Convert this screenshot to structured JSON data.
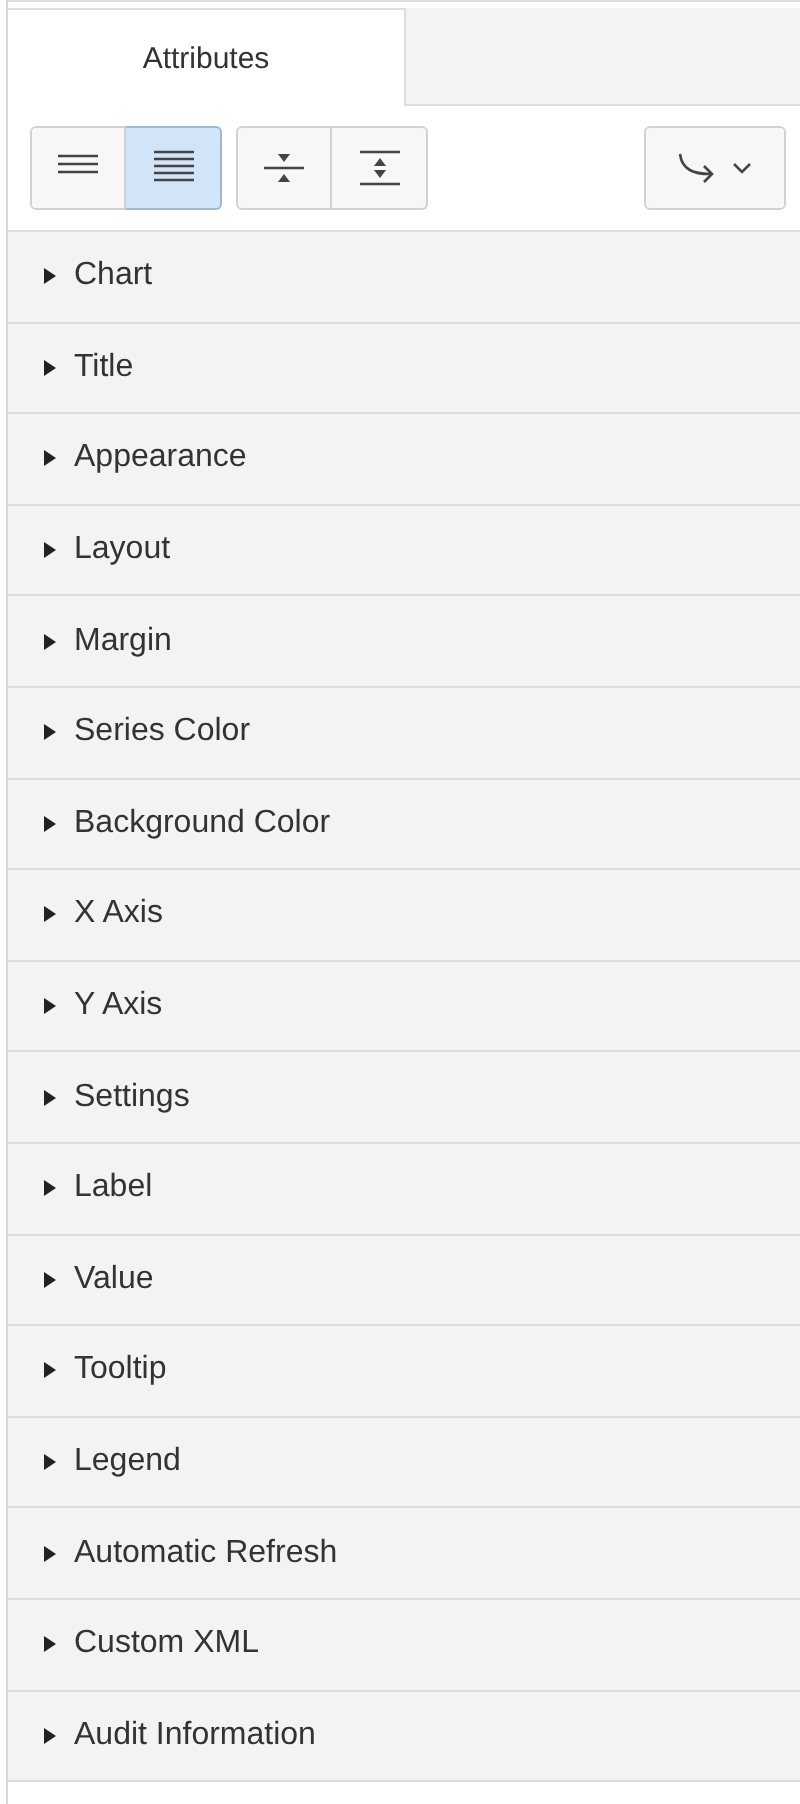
{
  "tabs": [
    {
      "label": "Attributes",
      "selected": true
    }
  ],
  "toolbar": {
    "groups": [
      [
        {
          "kind": "collapse-lines",
          "selected": false
        },
        {
          "kind": "expand-lines",
          "selected": true
        }
      ],
      [
        {
          "kind": "collapse-all",
          "selected": false
        },
        {
          "kind": "expand-all",
          "selected": false
        }
      ]
    ],
    "menu": {
      "kind": "go-to"
    }
  },
  "sections": [
    {
      "label": "Chart",
      "expanded": false
    },
    {
      "label": "Title",
      "expanded": false
    },
    {
      "label": "Appearance",
      "expanded": false
    },
    {
      "label": "Layout",
      "expanded": false
    },
    {
      "label": "Margin",
      "expanded": false
    },
    {
      "label": "Series Color",
      "expanded": false
    },
    {
      "label": "Background Color",
      "expanded": false
    },
    {
      "label": "X Axis",
      "expanded": false
    },
    {
      "label": "Y Axis",
      "expanded": false
    },
    {
      "label": "Settings",
      "expanded": false
    },
    {
      "label": "Label",
      "expanded": false
    },
    {
      "label": "Value",
      "expanded": false
    },
    {
      "label": "Tooltip",
      "expanded": false
    },
    {
      "label": "Legend",
      "expanded": false
    },
    {
      "label": "Automatic Refresh",
      "expanded": false
    },
    {
      "label": "Custom XML",
      "expanded": false
    },
    {
      "label": "Audit Information",
      "expanded": false
    }
  ]
}
